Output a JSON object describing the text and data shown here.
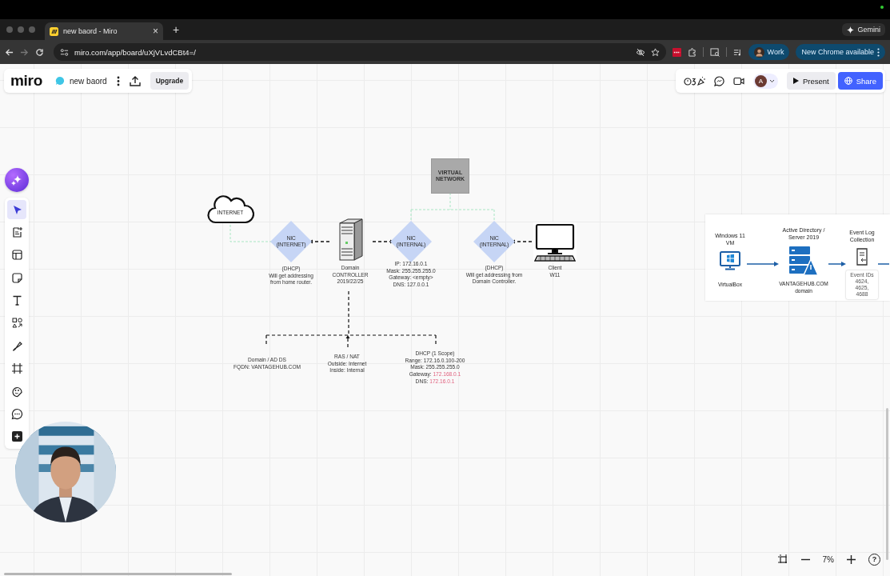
{
  "browser": {
    "tab": {
      "title": "new baord - Miro",
      "close": "×"
    },
    "new_tab": "+",
    "gemini": "Gemini",
    "url": "miro.com/app/board/uXjVLvdCBt4=/",
    "profile": "Work",
    "update": "New Chrome available"
  },
  "header": {
    "logo": "miro",
    "board_name": "new baord",
    "upgrade": "Upgrade"
  },
  "collab": {
    "avatar": "A",
    "present": "Present",
    "share": "Share"
  },
  "toolbar": {
    "items": [
      {
        "kind": "select",
        "selected": true
      },
      {
        "kind": "doc",
        "selected": false
      },
      {
        "kind": "layout",
        "selected": false
      },
      {
        "kind": "sticky",
        "selected": false
      },
      {
        "kind": "text",
        "selected": false
      },
      {
        "kind": "shapes",
        "selected": false
      },
      {
        "kind": "pen",
        "selected": false
      },
      {
        "kind": "frame",
        "selected": false
      },
      {
        "kind": "sticker",
        "selected": false
      },
      {
        "kind": "comment",
        "selected": false
      },
      {
        "kind": "more",
        "selected": false
      }
    ]
  },
  "diagram": {
    "nodes": [
      {
        "kind": "cloud",
        "lines": [
          "INTERNET"
        ]
      },
      {
        "kind": "box",
        "lines": [
          "VIRTUAL NETWORK"
        ]
      },
      {
        "kind": "diamond",
        "lines": [
          "NIC",
          "(INTERNET)"
        ]
      },
      {
        "kind": "server"
      },
      {
        "kind": "diamond",
        "lines": [
          "NIC",
          "(INTERNAL)"
        ]
      },
      {
        "kind": "diamond",
        "lines": [
          "NIC",
          "(INTERNAL)"
        ]
      },
      {
        "kind": "computer"
      }
    ],
    "captions": [
      {
        "lines": [
          "(DHCP)",
          "Will get addressing",
          "from home router."
        ]
      },
      {
        "lines": [
          "Domain",
          "CONTROLLER",
          "2019/22/25"
        ]
      },
      {
        "lines": [
          "IP: 172.16.0.1",
          "Mask: 255.255.255.0",
          "Gateway: <empty>",
          "DNS: 127.0.0.1"
        ]
      },
      {
        "lines": [
          "(DHCP)",
          "Will get addressing from",
          "Domain Controller."
        ]
      },
      {
        "lines": [
          "Client",
          "W11"
        ]
      },
      {
        "lines": [
          "Domain / AD DS",
          "FQDN: VANTAGEHUB.COM"
        ]
      },
      {
        "lines": [
          "RAS / NAT",
          "Outside: Internet",
          "Inside: Internal"
        ]
      },
      {
        "lines": [
          "DHCP (1 Scope)",
          "Range: 172.16.0.100-200",
          "Mask: 255.255.255.0",
          {
            "text": "Gateway:",
            "flag": "172.168.0.1"
          },
          {
            "text": "DNS:",
            "flag": "172.16.0.1"
          }
        ]
      }
    ]
  },
  "flow_card": {
    "steps": [
      {
        "kind": "vm",
        "title": "Windows 11\nVM",
        "caption": "VirtualBox"
      },
      {
        "kind": "server",
        "title": "Active Directory /\nServer 2019",
        "caption": "VANTAGEHUB.COM\ndomain"
      },
      {
        "kind": "log",
        "title": "Event Log\nCollection",
        "note": "Event IDs\n4624, 4625, 4688"
      }
    ]
  },
  "zoom": {
    "level_text": "7%",
    "help": "?"
  }
}
